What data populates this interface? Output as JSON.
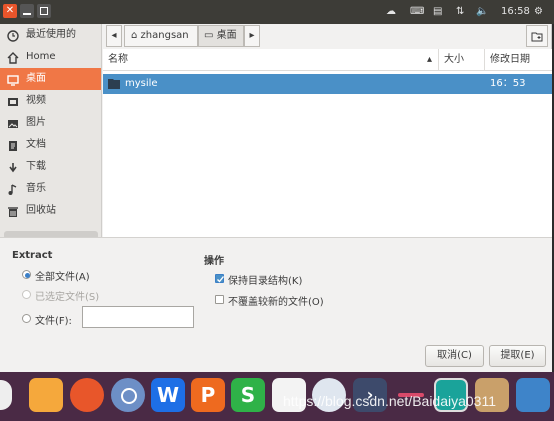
{
  "top_panel": {
    "time": "16:58"
  },
  "sidebar": {
    "items": [
      {
        "label": "最近使用的",
        "icon": "clock-icon"
      },
      {
        "label": "Home",
        "icon": "home-icon"
      },
      {
        "label": "桌面",
        "icon": "desktop-icon",
        "selected": true
      },
      {
        "label": "视频",
        "icon": "film-icon"
      },
      {
        "label": "图片",
        "icon": "picture-icon"
      },
      {
        "label": "文档",
        "icon": "document-icon"
      },
      {
        "label": "下载",
        "icon": "download-icon"
      },
      {
        "label": "音乐",
        "icon": "music-icon"
      },
      {
        "label": "回收站",
        "icon": "trash-icon"
      }
    ]
  },
  "path_bar": {
    "segments": [
      "zhangsan",
      "桌面"
    ]
  },
  "file_list": {
    "columns": {
      "name": "名称",
      "size": "大小",
      "modified": "修改日期"
    },
    "rows": [
      {
        "name": "mysile",
        "size": "",
        "modified": "16：53",
        "selected": true
      }
    ]
  },
  "extract": {
    "heading": "Extract",
    "all_files": "全部文件(A)",
    "selected_files": "已选定文件(S)",
    "files": "文件(F):",
    "files_value": "",
    "selected_option": "all_files"
  },
  "actions": {
    "heading": "操作",
    "keep_structure": "保持目录结构(K)",
    "keep_structure_checked": true,
    "no_overwrite": "不覆盖较新的文件(O)",
    "no_overwrite_checked": false
  },
  "buttons": {
    "cancel": "取消(C)",
    "extract": "提取(E)"
  },
  "dock": {
    "apps": [
      "W",
      "P",
      "S"
    ]
  },
  "watermark": "https://blog.csdn.net/Baidaiya0311",
  "colors": {
    "accent": "#f07746",
    "selection": "#4a90c7",
    "dock": "#4a2a45",
    "panel": "#3d3c37"
  }
}
